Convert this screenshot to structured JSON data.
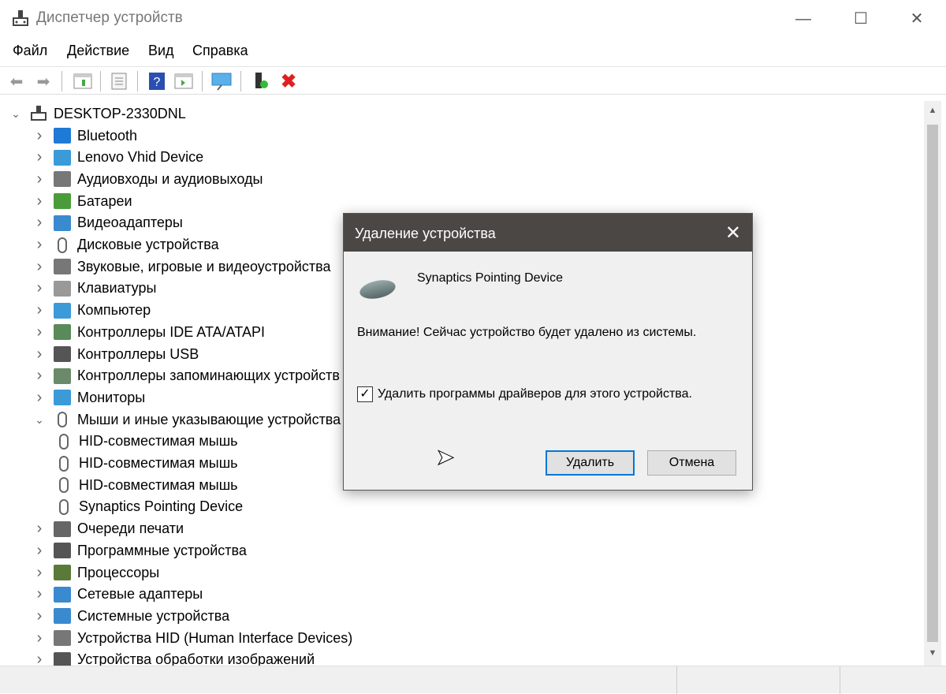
{
  "window": {
    "title": "Диспетчер устройств",
    "minimize": "—",
    "maximize": "☐",
    "close": "✕"
  },
  "menu": [
    "Файл",
    "Действие",
    "Вид",
    "Справка"
  ],
  "tree": {
    "root": "DESKTOP-2330DNL",
    "items": [
      {
        "label": "Bluetooth",
        "expanded": false,
        "level": 1,
        "color": "#1e7ad6"
      },
      {
        "label": "Lenovo Vhid Device",
        "expanded": false,
        "level": 1,
        "color": "#3a9bd8"
      },
      {
        "label": "Аудиовходы и аудиовыходы",
        "expanded": false,
        "level": 1,
        "color": "#777"
      },
      {
        "label": "Батареи",
        "expanded": false,
        "level": 1,
        "color": "#4a9c3a"
      },
      {
        "label": "Видеоадаптеры",
        "expanded": false,
        "level": 1,
        "color": "#3a8ad0"
      },
      {
        "label": "Дисковые устройства",
        "expanded": false,
        "level": 1,
        "color": "#888"
      },
      {
        "label": "Звуковые, игровые и видеоустройства",
        "expanded": false,
        "level": 1,
        "color": "#777"
      },
      {
        "label": "Клавиатуры",
        "expanded": false,
        "level": 1,
        "color": "#999"
      },
      {
        "label": "Компьютер",
        "expanded": false,
        "level": 1,
        "color": "#3a9bd8"
      },
      {
        "label": "Контроллеры IDE ATA/ATAPI",
        "expanded": false,
        "level": 1,
        "color": "#5a8a5a"
      },
      {
        "label": "Контроллеры USB",
        "expanded": false,
        "level": 1,
        "color": "#555"
      },
      {
        "label": "Контроллеры запоминающих устройств",
        "expanded": false,
        "level": 1,
        "color": "#6a8a6a"
      },
      {
        "label": "Мониторы",
        "expanded": false,
        "level": 1,
        "color": "#3a9bd8"
      },
      {
        "label": "Мыши и иные указывающие устройства",
        "expanded": true,
        "level": 1,
        "color": "#888"
      },
      {
        "label": "HID-совместимая мышь",
        "level": 2,
        "color": "#888"
      },
      {
        "label": "HID-совместимая мышь",
        "level": 2,
        "color": "#888"
      },
      {
        "label": "HID-совместимая мышь",
        "level": 2,
        "color": "#888"
      },
      {
        "label": "Synaptics Pointing Device",
        "level": 2,
        "color": "#888"
      },
      {
        "label": "Очереди печати",
        "expanded": false,
        "level": 1,
        "color": "#666"
      },
      {
        "label": "Программные устройства",
        "expanded": false,
        "level": 1,
        "color": "#555"
      },
      {
        "label": "Процессоры",
        "expanded": false,
        "level": 1,
        "color": "#5a7a3a"
      },
      {
        "label": "Сетевые адаптеры",
        "expanded": false,
        "level": 1,
        "color": "#3a8ad0"
      },
      {
        "label": "Системные устройства",
        "expanded": false,
        "level": 1,
        "color": "#3a8ad0"
      },
      {
        "label": "Устройства HID (Human Interface Devices)",
        "expanded": false,
        "level": 1,
        "color": "#777"
      },
      {
        "label": "Устройства обработки изображений",
        "expanded": false,
        "level": 1,
        "color": "#555"
      }
    ]
  },
  "dialog": {
    "title": "Удаление устройства",
    "close": "✕",
    "device": "Synaptics Pointing Device",
    "warning": "Внимание! Сейчас устройство будет удалено из системы.",
    "checkbox_label": "Удалить программы драйверов для этого устройства.",
    "checkbox_checked": true,
    "check_mark": "✓",
    "ok": "Удалить",
    "cancel": "Отмена"
  }
}
